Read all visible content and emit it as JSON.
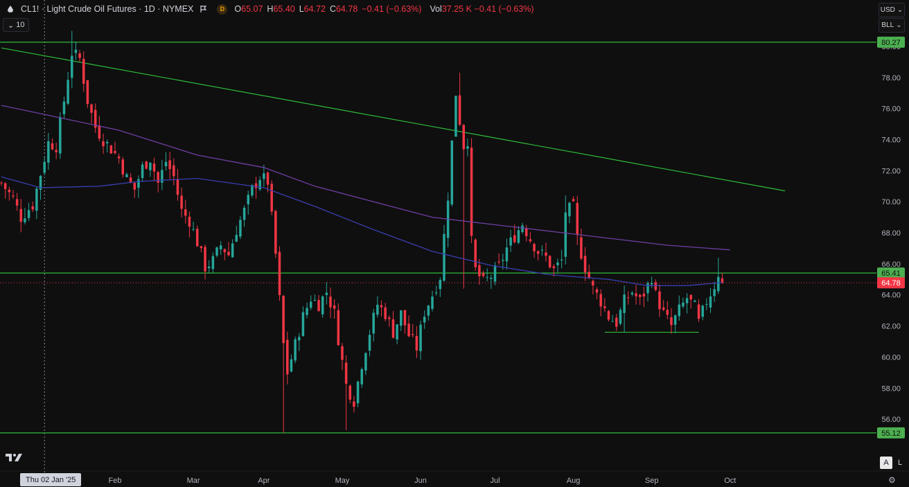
{
  "header": {
    "title": "CL1! · Light Crude Oil Futures · 1D · NYMEX",
    "source_badge": "D",
    "ohlc": [
      {
        "k": "O",
        "v": "65.07"
      },
      {
        "k": "H",
        "v": "65.40"
      },
      {
        "k": "L",
        "v": "64.72"
      },
      {
        "k": "C",
        "v": "64.78"
      },
      {
        "k": "",
        "v": "−0.41 (−0.63%)"
      }
    ],
    "vol_label": "Vol",
    "vol_value": "37.25 K −0.41 (−0.63%)"
  },
  "indicator_row": {
    "label": "10"
  },
  "currency_button": "USD",
  "unit_button": "BLL",
  "crosshair_date": "Thu 02 Jan '25",
  "bottom_buttons": {
    "auto": "A",
    "log": "L"
  },
  "colors": {
    "up": "#26a69a",
    "down": "#f23645",
    "green_line": "#2ebd3a",
    "ma_purple": "#6f3fa4",
    "ma_blue": "#3a3fb0",
    "last_price": "#f23645",
    "background": "#0f0f0f"
  },
  "icons": [
    "drop-icon",
    "flag-icon",
    "chevron-down-icon",
    "gear-icon",
    "tradingview-logo"
  ],
  "chart_data": {
    "type": "candlestick",
    "symbol": "CL1!",
    "interval": "1D",
    "ylim": [
      54.0,
      81.2
    ],
    "y_ticks": [
      56,
      58,
      60,
      62,
      64,
      66,
      68,
      70,
      72,
      74,
      76,
      78,
      80
    ],
    "y_tick_labels": [
      "56.00",
      "58.00",
      "60.00",
      "62.00",
      "64.00",
      "66.00",
      "68.00",
      "70.00",
      "72.00",
      "74.00",
      "76.00",
      "78.00",
      "80.00"
    ],
    "x_index_range": [
      0,
      223
    ],
    "x_ticks": [
      {
        "label": "Feb",
        "index": 29
      },
      {
        "label": "Mar",
        "index": 49
      },
      {
        "label": "Apr",
        "index": 67
      },
      {
        "label": "May",
        "index": 87
      },
      {
        "label": "Jun",
        "index": 107
      },
      {
        "label": "Jul",
        "index": 126
      },
      {
        "label": "Aug",
        "index": 146
      },
      {
        "label": "Sep",
        "index": 166
      },
      {
        "label": "Oct",
        "index": 186
      }
    ],
    "crosshair_index": 11,
    "price_levels": [
      {
        "label": "80.27",
        "value": 80.27
      },
      {
        "label": "65.41",
        "value": 65.41
      },
      {
        "label": "55.12",
        "value": 55.12
      }
    ],
    "last_price": {
      "label": "64.78",
      "value": 64.78
    },
    "trendline": [
      [
        0,
        79.9
      ],
      [
        200,
        70.7
      ]
    ],
    "support_segment": [
      [
        154,
        61.6
      ],
      [
        178,
        61.6
      ]
    ],
    "anchors": [
      [
        0,
        71.2
      ],
      [
        3,
        70.2
      ],
      [
        5,
        69.0
      ],
      [
        8,
        69.8
      ],
      [
        10,
        71.8
      ],
      [
        12,
        73.8
      ],
      [
        14,
        73.6
      ],
      [
        16,
        76.5
      ],
      [
        18,
        79.6
      ],
      [
        20,
        79.2
      ],
      [
        22,
        76.5
      ],
      [
        24,
        74.8
      ],
      [
        26,
        74.0
      ],
      [
        28,
        73.4
      ],
      [
        30,
        72.8
      ],
      [
        32,
        71.5
      ],
      [
        34,
        70.8
      ],
      [
        36,
        72.2
      ],
      [
        38,
        72.8
      ],
      [
        40,
        71.2
      ],
      [
        42,
        72.6
      ],
      [
        44,
        71.6
      ],
      [
        46,
        69.4
      ],
      [
        48,
        68.8
      ],
      [
        50,
        67.4
      ],
      [
        52,
        65.8
      ],
      [
        54,
        66.2
      ],
      [
        56,
        67.2
      ],
      [
        58,
        66.6
      ],
      [
        60,
        68.2
      ],
      [
        62,
        69.4
      ],
      [
        64,
        70.8
      ],
      [
        66,
        71.6
      ],
      [
        68,
        71.3
      ],
      [
        70,
        66.6
      ],
      [
        72,
        60.8
      ],
      [
        73,
        59.0
      ],
      [
        75,
        60.8
      ],
      [
        77,
        62.6
      ],
      [
        79,
        63.8
      ],
      [
        81,
        63.4
      ],
      [
        83,
        64.2
      ],
      [
        85,
        62.8
      ],
      [
        86,
        61.2
      ],
      [
        88,
        58.2
      ],
      [
        90,
        57.2
      ],
      [
        92,
        59.6
      ],
      [
        94,
        61.6
      ],
      [
        96,
        63.4
      ],
      [
        98,
        62.8
      ],
      [
        100,
        61.6
      ],
      [
        102,
        62.8
      ],
      [
        104,
        61.4
      ],
      [
        106,
        60.6
      ],
      [
        108,
        62.9
      ],
      [
        110,
        64.0
      ],
      [
        112,
        65.2
      ],
      [
        114,
        70.4
      ],
      [
        115,
        73.8
      ],
      [
        116,
        77.0
      ],
      [
        117,
        75.2
      ],
      [
        118,
        73.6
      ],
      [
        119,
        74.0
      ],
      [
        120,
        67.4
      ],
      [
        121,
        65.6
      ],
      [
        123,
        64.8
      ],
      [
        125,
        65.2
      ],
      [
        127,
        65.8
      ],
      [
        129,
        67.0
      ],
      [
        131,
        67.8
      ],
      [
        133,
        68.6
      ],
      [
        135,
        67.6
      ],
      [
        137,
        66.8
      ],
      [
        139,
        66.4
      ],
      [
        141,
        65.6
      ],
      [
        143,
        66.2
      ],
      [
        144,
        69.4
      ],
      [
        146,
        69.6
      ],
      [
        147,
        67.6
      ],
      [
        149,
        65.8
      ],
      [
        151,
        64.4
      ],
      [
        153,
        63.6
      ],
      [
        155,
        62.6
      ],
      [
        157,
        62.2
      ],
      [
        159,
        63.6
      ],
      [
        161,
        64.2
      ],
      [
        163,
        63.6
      ],
      [
        165,
        64.6
      ],
      [
        166,
        65.2
      ],
      [
        167,
        64.0
      ],
      [
        169,
        62.8
      ],
      [
        171,
        62.0
      ],
      [
        173,
        63.0
      ],
      [
        175,
        63.8
      ],
      [
        177,
        63.2
      ],
      [
        178,
        62.2
      ],
      [
        180,
        63.6
      ],
      [
        182,
        64.6
      ],
      [
        183,
        65.4
      ],
      [
        184,
        64.78
      ]
    ],
    "spikes": [
      [
        18,
        81.0,
        null
      ],
      [
        72,
        null,
        55.12
      ],
      [
        88,
        null,
        55.3
      ],
      [
        117,
        78.3,
        null
      ],
      [
        118,
        null,
        64.4
      ],
      [
        144,
        70.4,
        null
      ],
      [
        159,
        null,
        61.6
      ],
      [
        171,
        null,
        61.5
      ],
      [
        183,
        66.4,
        null
      ]
    ],
    "last_candle": {
      "index": 184,
      "open": 65.07,
      "high": 65.4,
      "low": 64.72,
      "close": 64.78
    },
    "ma_purple_points": [
      [
        0,
        76.2
      ],
      [
        30,
        74.6
      ],
      [
        50,
        73.0
      ],
      [
        67,
        72.2
      ],
      [
        80,
        71.0
      ],
      [
        95,
        70.0
      ],
      [
        110,
        69.0
      ],
      [
        130,
        68.4
      ],
      [
        150,
        67.8
      ],
      [
        170,
        67.2
      ],
      [
        186,
        66.9
      ]
    ],
    "ma_blue_points": [
      [
        0,
        71.6
      ],
      [
        10,
        70.9
      ],
      [
        25,
        71.0
      ],
      [
        35,
        71.3
      ],
      [
        50,
        71.5
      ],
      [
        67,
        70.9
      ],
      [
        80,
        69.7
      ],
      [
        95,
        68.2
      ],
      [
        110,
        66.8
      ],
      [
        125,
        65.9
      ],
      [
        140,
        65.3
      ],
      [
        155,
        65.0
      ],
      [
        165,
        64.6
      ],
      [
        175,
        64.6
      ],
      [
        184,
        64.8
      ]
    ]
  }
}
